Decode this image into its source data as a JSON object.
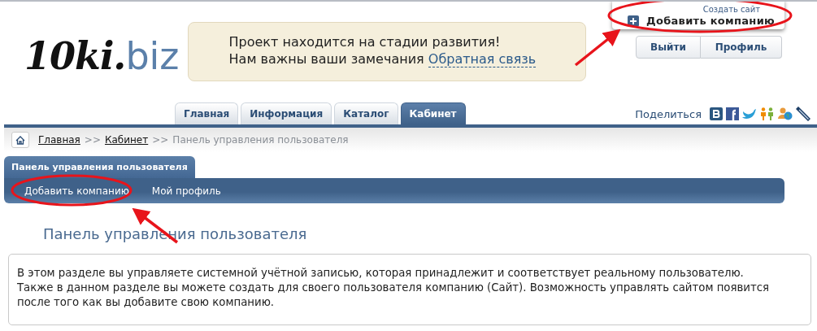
{
  "logo": {
    "script": "10ki.",
    "domain": "biz"
  },
  "notice": {
    "line_1": "Проект находится на стадии развития!",
    "line_2": "Нам важны ваши замечания",
    "link": "Обратная связь"
  },
  "add_company": {
    "caption": "Создать сайт",
    "label": "Добавить компанию"
  },
  "account_buttons": [
    "Выйти",
    "Профиль"
  ],
  "tabs": [
    {
      "label": "Главная",
      "selected": false
    },
    {
      "label": "Информация",
      "selected": false
    },
    {
      "label": "Каталог",
      "selected": false
    },
    {
      "label": "Кабинет",
      "selected": true
    }
  ],
  "share": {
    "label": "Поделиться"
  },
  "breadcrumb": {
    "links": [
      "Главная",
      "Кабинет"
    ],
    "separator": ">>",
    "current": "Панель управления пользователя"
  },
  "panel": {
    "tab": "Панель управления пользователя",
    "menu": [
      "Добавить компанию",
      "Мой профиль"
    ]
  },
  "heading": "Панель управления пользователя",
  "info": [
    "В этом разделе вы управляете системной учётной записью, которая принадлежит и соответствует реальному пользователю.",
    "Также в данном разделе вы можете создать для своего пользователя компанию (Сайт). Возможность управлять сайтом появится",
    "после того как вы добавите свою компанию."
  ]
}
